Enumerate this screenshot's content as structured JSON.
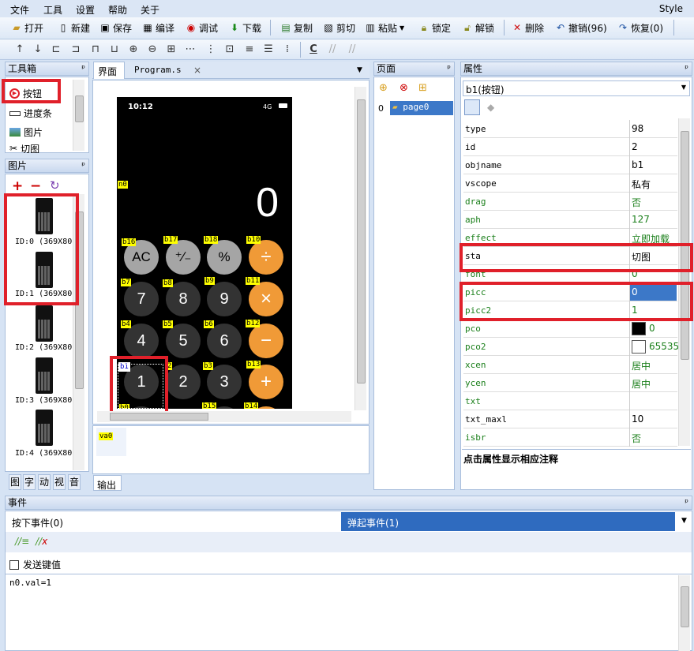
{
  "menu": {
    "items": [
      "文件",
      "工具",
      "设置",
      "帮助",
      "关于"
    ],
    "style": "Style"
  },
  "toolbar": {
    "open": "打开",
    "new": "新建",
    "save": "保存",
    "compile": "编译",
    "debug": "调试",
    "download": "下载",
    "copy": "复制",
    "cut": "剪切",
    "paste": "粘贴",
    "lock": "锁定",
    "unlock": "解锁",
    "delete": "删除",
    "undo": "撤销(96)",
    "redo": "恢复(0)"
  },
  "toolbar2": {
    "c_label": "C"
  },
  "toolbox": {
    "title": "工具箱",
    "items": [
      "按钮",
      "进度条",
      "图片",
      "切图"
    ]
  },
  "images": {
    "title": "图片",
    "items": [
      "ID:0  (369X80",
      "ID:1  (369X80",
      "ID:2  (369X80",
      "ID:3  (369X80",
      "ID:4  (369X80"
    ]
  },
  "left_tabs": [
    "图",
    "字",
    "动",
    "视",
    "音"
  ],
  "editor": {
    "tabs": [
      "界面",
      "Program.s"
    ],
    "phone_time": "10:12",
    "phone_signal": "4G",
    "display": "0",
    "keys": [
      "AC",
      "⁺∕₋",
      "%",
      "÷",
      "7",
      "8",
      "9",
      "×",
      "4",
      "5",
      "6",
      "−",
      "1",
      "2",
      "3",
      "+"
    ],
    "tags": [
      "n0",
      "b16",
      "b17",
      "b18",
      "b10",
      "b7",
      "b8",
      "b9",
      "b11",
      "b4",
      "b5",
      "b6",
      "b12",
      "b1",
      "2",
      "b3",
      "b13",
      "b0",
      "b15",
      "b14"
    ],
    "var_label": "va0",
    "output_tab": "输出"
  },
  "pages": {
    "title": "页面",
    "index": "0",
    "page": "page0"
  },
  "properties": {
    "title": "属性",
    "selector": "b1(按钮)",
    "rows": [
      {
        "k": "type",
        "v": "98",
        "color": "black"
      },
      {
        "k": "id",
        "v": "2",
        "color": "black"
      },
      {
        "k": "objname",
        "v": "b1",
        "color": "black"
      },
      {
        "k": "vscope",
        "v": "私有",
        "color": "black"
      },
      {
        "k": "drag",
        "v": "否",
        "color": "green"
      },
      {
        "k": "aph",
        "v": "127",
        "color": "green"
      },
      {
        "k": "effect",
        "v": "立即加载",
        "color": "green"
      },
      {
        "k": "sta",
        "v": "切图",
        "color": "black"
      },
      {
        "k": "font",
        "v": "0",
        "color": "green"
      },
      {
        "k": "picc",
        "v": "0",
        "color": "green"
      },
      {
        "k": "picc2",
        "v": "1",
        "color": "green"
      },
      {
        "k": "pco",
        "v": "0",
        "color": "green"
      },
      {
        "k": "pco2",
        "v": "65535",
        "color": "green"
      },
      {
        "k": "xcen",
        "v": "居中",
        "color": "green"
      },
      {
        "k": "ycen",
        "v": "居中",
        "color": "green"
      },
      {
        "k": "txt",
        "v": "",
        "color": "green"
      },
      {
        "k": "txt_maxl",
        "v": "10",
        "color": "black"
      },
      {
        "k": "isbr",
        "v": "否",
        "color": "green"
      }
    ],
    "hint": "点击属性显示相应注释"
  },
  "events": {
    "title": "事件",
    "tab_press": "按下事件(0)",
    "tab_release": "弹起事件(1)",
    "send_key": "发送键值",
    "code": "n0.val=1"
  },
  "colors": {
    "accent": "#3c78c8",
    "red": "#e0202a",
    "orange": "#f09a37"
  }
}
